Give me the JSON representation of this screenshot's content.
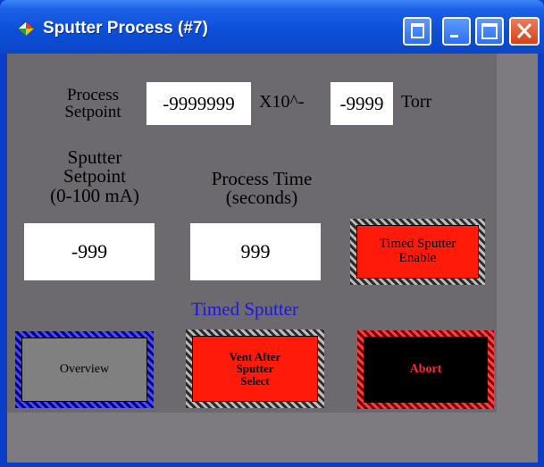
{
  "window": {
    "title": "Sputter Process (#7)",
    "colors": {
      "titlebar": "#0b46c9",
      "panel": "#6c6a6f",
      "client": "#7d7b80"
    }
  },
  "titlebar_buttons": {
    "restore_icon": "restore-window-icon",
    "minimize_icon": "minimize-icon",
    "maximize_icon": "maximize-icon",
    "close_icon": "close-icon"
  },
  "process_setpoint": {
    "label_line1": "Process",
    "label_line2": "Setpoint",
    "mantissa": "-9999999",
    "multiplier": "X10^-",
    "exponent": "-9999",
    "unit": "Torr"
  },
  "sputter_setpoint": {
    "label_line1": "Sputter",
    "label_line2": "Setpoint",
    "label_line3": "(0-100 mA)",
    "value": "-999"
  },
  "process_time": {
    "label_line1": "Process Time",
    "label_line2": "(seconds)",
    "value": "999"
  },
  "timed_sputter": {
    "enable_line1": "Timed Sputter",
    "enable_line2": "Enable",
    "section_label": "Timed Sputter",
    "section_label_color": "#1a16e6"
  },
  "buttons": {
    "overview": "Overview",
    "vent_line1": "Vent After",
    "vent_line2": "Sputter",
    "vent_line3": "Select",
    "abort": "Abort"
  }
}
